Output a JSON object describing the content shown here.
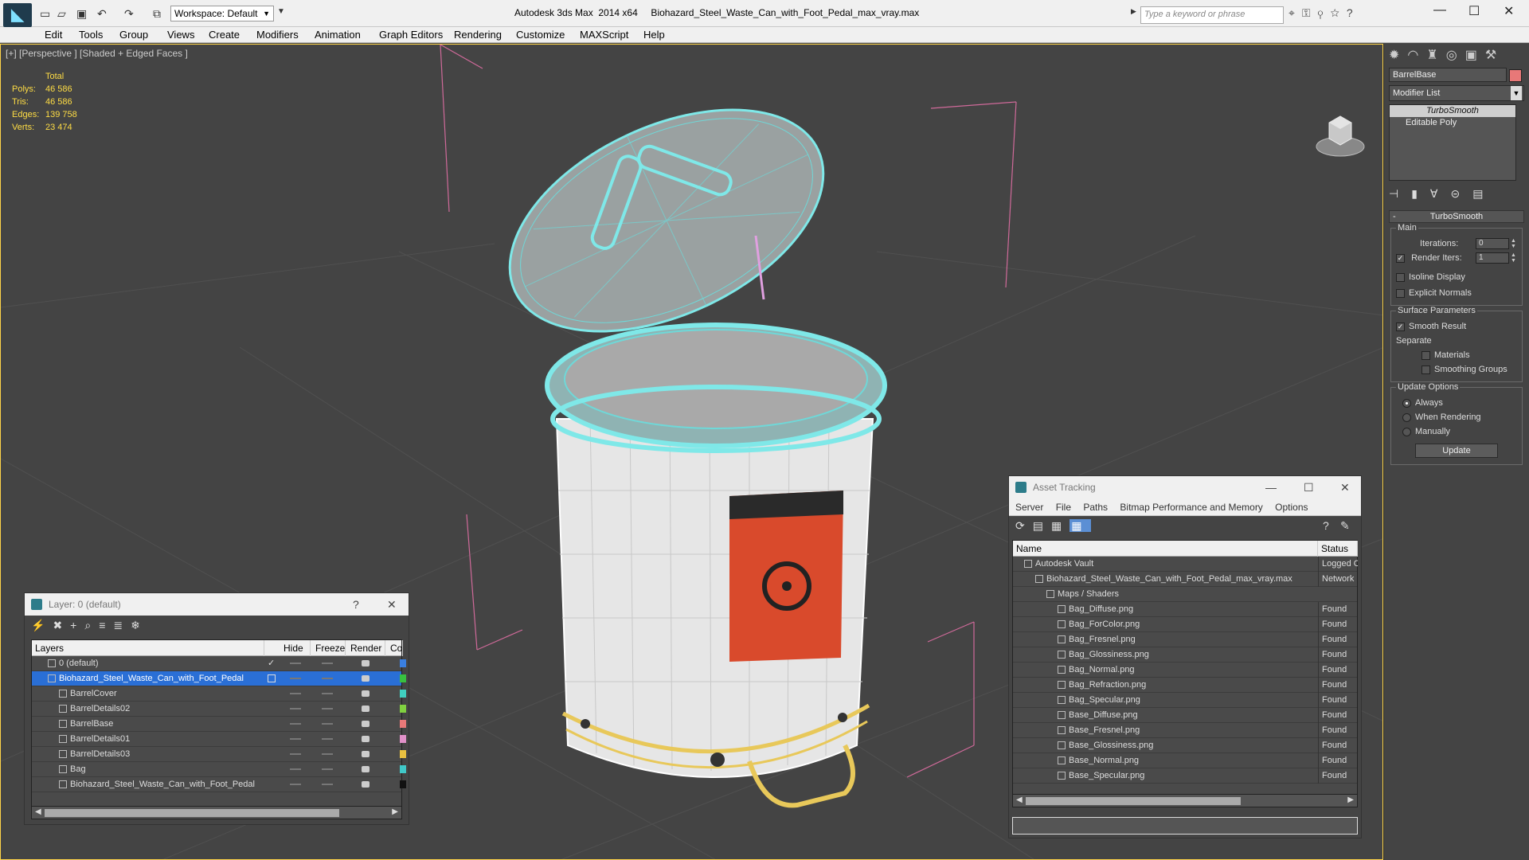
{
  "titlebar": {
    "workspace": "Workspace: Default",
    "app_title": "Autodesk 3ds Max  2014 x64     Biohazard_Steel_Waste_Can_with_Foot_Pedal_max_vray.max",
    "search_placeholder": "Type a keyword or phrase"
  },
  "menubar": [
    "Edit",
    "Tools",
    "Group",
    "Views",
    "Create",
    "Modifiers",
    "Animation",
    "Graph Editors",
    "Rendering",
    "Customize",
    "MAXScript",
    "Help"
  ],
  "viewport": {
    "label": "[+] [Perspective ] [Shaded + Edged Faces ]",
    "stats_header": "Total",
    "stats": [
      {
        "k": "Polys:",
        "v": "46 586"
      },
      {
        "k": "Tris:",
        "v": "46 586"
      },
      {
        "k": "Edges:",
        "v": "139 758"
      },
      {
        "k": "Verts:",
        "v": "23 474"
      }
    ]
  },
  "command_panel": {
    "object_name": "BarrelBase",
    "object_color": "#e87878",
    "modifier_list": "Modifier List",
    "stack": [
      "TurboSmooth",
      "Editable Poly"
    ],
    "rollout_title": "TurboSmooth",
    "main_label": "Main",
    "iterations_label": "Iterations:",
    "iterations_value": "0",
    "render_iters_label": "Render Iters:",
    "render_iters_value": "1",
    "isoline": "Isoline Display",
    "explicit_normals": "Explicit Normals",
    "surface_label": "Surface Parameters",
    "smooth_result": "Smooth Result",
    "separate_label": "Separate",
    "materials": "Materials",
    "smoothing_groups": "Smoothing Groups",
    "update_options_label": "Update Options",
    "always": "Always",
    "when_rendering": "When Rendering",
    "manually": "Manually",
    "update_button": "Update"
  },
  "layer_panel": {
    "title": "Layer: 0 (default)",
    "help": "?",
    "columns": [
      "Layers",
      "Hide",
      "Freeze",
      "Render",
      "Col"
    ],
    "rows": [
      {
        "name": "0 (default)",
        "indent": 1,
        "color": "#3a7fe0"
      },
      {
        "name": "Biohazard_Steel_Waste_Can_with_Foot_Pedal",
        "indent": 1,
        "color": "#38c040",
        "selected": true
      },
      {
        "name": "BarrelCover",
        "indent": 2,
        "color": "#40d0c0"
      },
      {
        "name": "BarrelDetails02",
        "indent": 2,
        "color": "#80d040"
      },
      {
        "name": "BarrelBase",
        "indent": 2,
        "color": "#e87878"
      },
      {
        "name": "BarrelDetails01",
        "indent": 2,
        "color": "#e090c8"
      },
      {
        "name": "BarrelDetails03",
        "indent": 2,
        "color": "#e8c040"
      },
      {
        "name": "Bag",
        "indent": 2,
        "color": "#40c8c8"
      },
      {
        "name": "Biohazard_Steel_Waste_Can_with_Foot_Pedal",
        "indent": 2,
        "color": "#111111"
      }
    ]
  },
  "asset_panel": {
    "title": "Asset Tracking",
    "menu": [
      "Server",
      "File",
      "Paths",
      "Bitmap Performance and Memory",
      "Options"
    ],
    "columns": [
      "Name",
      "Status"
    ],
    "rows": [
      {
        "name": "Autodesk Vault",
        "indent": 1,
        "status": "Logged Out"
      },
      {
        "name": "Biohazard_Steel_Waste_Can_with_Foot_Pedal_max_vray.max",
        "indent": 2,
        "status": "Network"
      },
      {
        "name": "Maps / Shaders",
        "indent": 3,
        "status": ""
      },
      {
        "name": "Bag_Diffuse.png",
        "indent": 4,
        "status": "Found"
      },
      {
        "name": "Bag_ForColor.png",
        "indent": 4,
        "status": "Found"
      },
      {
        "name": "Bag_Fresnel.png",
        "indent": 4,
        "status": "Found"
      },
      {
        "name": "Bag_Glossiness.png",
        "indent": 4,
        "status": "Found"
      },
      {
        "name": "Bag_Normal.png",
        "indent": 4,
        "status": "Found"
      },
      {
        "name": "Bag_Refraction.png",
        "indent": 4,
        "status": "Found"
      },
      {
        "name": "Bag_Specular.png",
        "indent": 4,
        "status": "Found"
      },
      {
        "name": "Base_Diffuse.png",
        "indent": 4,
        "status": "Found"
      },
      {
        "name": "Base_Fresnel.png",
        "indent": 4,
        "status": "Found"
      },
      {
        "name": "Base_Glossiness.png",
        "indent": 4,
        "status": "Found"
      },
      {
        "name": "Base_Normal.png",
        "indent": 4,
        "status": "Found"
      },
      {
        "name": "Base_Specular.png",
        "indent": 4,
        "status": "Found"
      }
    ]
  }
}
